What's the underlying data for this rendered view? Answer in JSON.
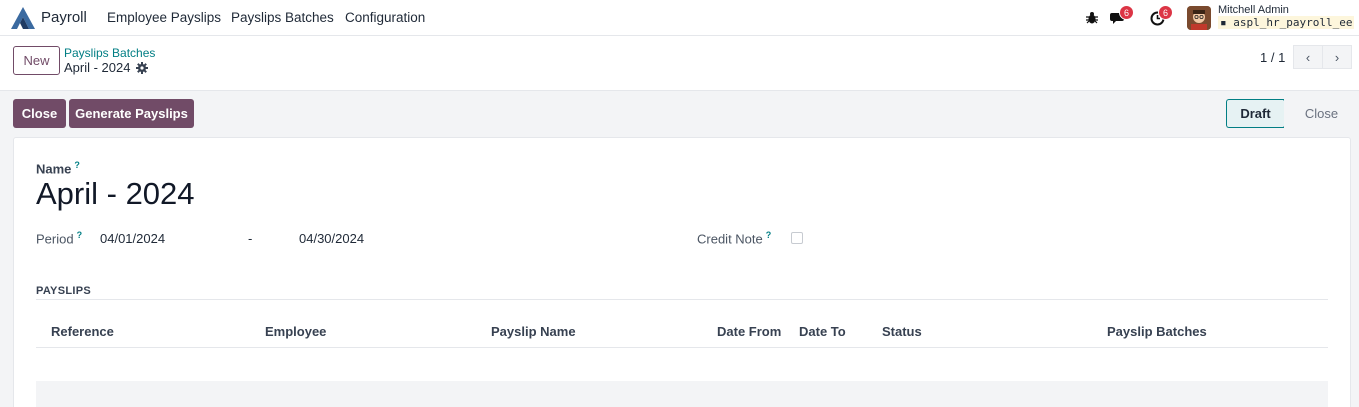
{
  "navbar": {
    "app_name": "Payroll",
    "menu": [
      "Employee Payslips",
      "Payslips Batches",
      "Configuration"
    ],
    "messages_count": "6",
    "activities_count": "6",
    "user_name": "Mitchell Admin",
    "database": "aspl_hr_payroll_ee"
  },
  "control": {
    "new_label": "New",
    "breadcrumb_parent": "Payslips Batches",
    "breadcrumb_current": "April - 2024",
    "pager": "1 / 1"
  },
  "actions": {
    "close_label": "Close",
    "generate_label": "Generate Payslips"
  },
  "statusbar": {
    "stages": [
      "Draft",
      "Close"
    ],
    "active": "Draft"
  },
  "form": {
    "name_label": "Name",
    "help_mark": "?",
    "name_value": "April - 2024",
    "period_label": "Period",
    "date_start": "04/01/2024",
    "date_separator": "-",
    "date_end": "04/30/2024",
    "credit_note_label": "Credit Note",
    "credit_note_checked": false
  },
  "payslips": {
    "section_title": "PAYSLIPS",
    "columns": [
      "Reference",
      "Employee",
      "Payslip Name",
      "Date From",
      "Date To",
      "Status",
      "Payslip Batches"
    ],
    "rows": []
  },
  "colors": {
    "brand": "#714b67",
    "link": "#017e84",
    "badge": "#dc3545"
  }
}
